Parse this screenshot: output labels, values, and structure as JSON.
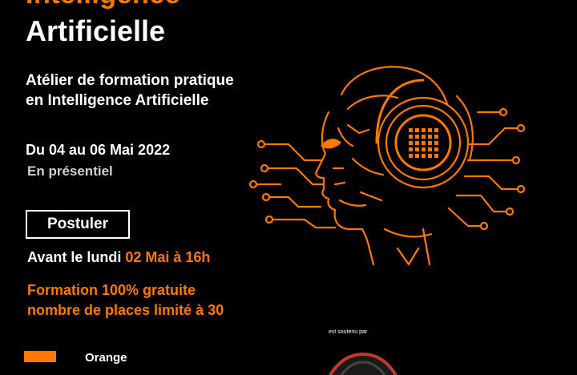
{
  "header": {
    "title_line_1": "Intelligence",
    "title_line_2": "Artificielle"
  },
  "subtitle_lines": [
    "Atélier de formation pratique",
    "en Intelligence Artificielle"
  ],
  "event": {
    "dates": "Du 04 au 06 Mai 2022",
    "mode": "En présentiel"
  },
  "apply": {
    "button_label": "Postuler",
    "deadline_prefix": "Avant le lundi ",
    "deadline_highlight": "02 Mai à 16h"
  },
  "offer_lines": [
    "Formation 100% gratuite",
    "nombre de places limité à 30"
  ],
  "footer": {
    "brand": "Orange",
    "supported_by": "est soutenu par"
  },
  "colors": {
    "background": "#000000",
    "accent": "#ff7900",
    "text": "#ffffff"
  },
  "illustration": "ai-robot-head-icon"
}
